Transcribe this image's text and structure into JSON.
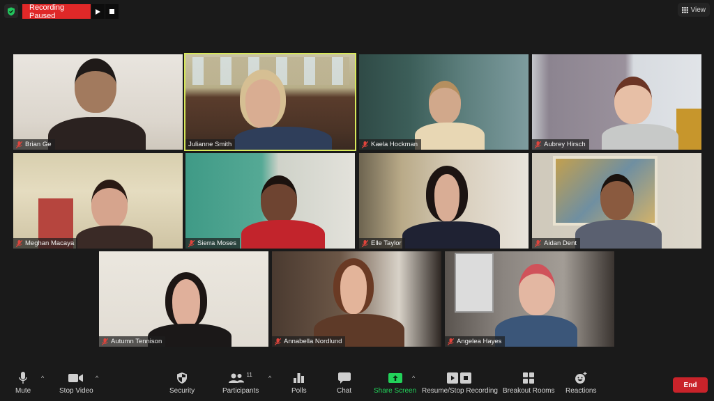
{
  "topbar": {
    "security_status_icon": "shield-check-icon",
    "recording_label": "Recording Paused",
    "resume_icon": "play-icon",
    "stop_icon": "stop-icon",
    "view_label": "View",
    "view_icon": "grid-icon"
  },
  "participants": [
    {
      "name": "Brian Ge",
      "muted": true,
      "active_speaker": false
    },
    {
      "name": "Julianne Smith",
      "muted": false,
      "active_speaker": true
    },
    {
      "name": "Kaela Hockman",
      "muted": true,
      "active_speaker": false
    },
    {
      "name": "Aubrey Hirsch",
      "muted": true,
      "active_speaker": false
    },
    {
      "name": "Meghan Macaya",
      "muted": true,
      "active_speaker": false
    },
    {
      "name": "Sierra Moses",
      "muted": true,
      "active_speaker": false
    },
    {
      "name": "Elle Taylor",
      "muted": true,
      "active_speaker": false
    },
    {
      "name": "Aidan Dent",
      "muted": true,
      "active_speaker": false
    },
    {
      "name": "Autumn Tennison",
      "muted": true,
      "active_speaker": false
    },
    {
      "name": "Annabella Nordlund",
      "muted": true,
      "active_speaker": false
    },
    {
      "name": "Angelea Hayes",
      "muted": true,
      "active_speaker": false
    }
  ],
  "toolbar": {
    "mute_label": "Mute",
    "stop_video_label": "Stop Video",
    "security_label": "Security",
    "participants_label": "Participants",
    "participants_count": "11",
    "polls_label": "Polls",
    "chat_label": "Chat",
    "share_screen_label": "Share Screen",
    "recording_label": "Resume/Stop Recording",
    "breakout_label": "Breakout Rooms",
    "reactions_label": "Reactions",
    "end_label": "End",
    "caret": "^"
  },
  "colors": {
    "recording_red": "#e02828",
    "active_speaker_border": "#d7e85a",
    "share_green": "#22d25a",
    "end_red": "#c9232a",
    "mute_icon_red": "#e0443c"
  }
}
